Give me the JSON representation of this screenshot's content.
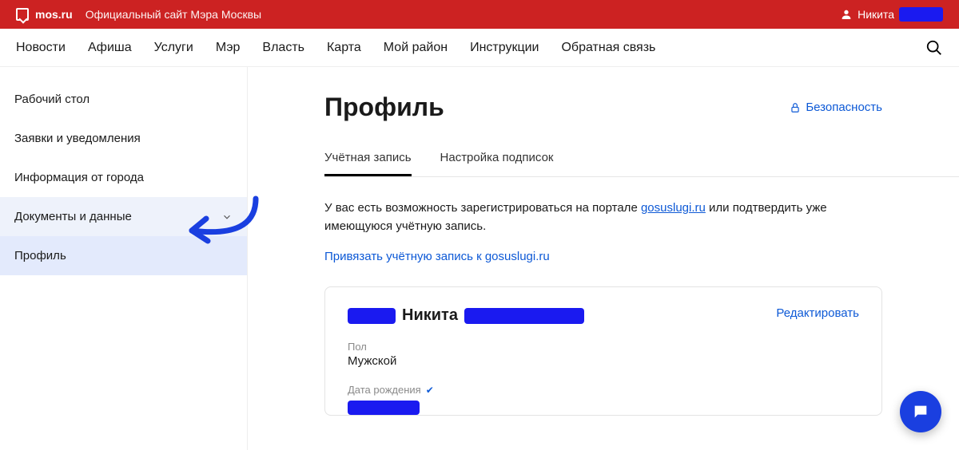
{
  "topbar": {
    "logo": "mos.ru",
    "subtitle": "Официальный сайт Мэра Москвы",
    "user_name": "Никита"
  },
  "nav": {
    "items": [
      "Новости",
      "Афиша",
      "Услуги",
      "Мэр",
      "Власть",
      "Карта",
      "Мой район",
      "Инструкции",
      "Обратная связь"
    ]
  },
  "sidebar": {
    "items": [
      "Рабочий стол",
      "Заявки и уведомления",
      "Информация от города",
      "Документы и данные",
      "Профиль"
    ]
  },
  "page": {
    "title": "Профиль",
    "security": "Безопасность"
  },
  "tabs": {
    "items": [
      "Учётная запись",
      "Настройка подписок"
    ]
  },
  "info": {
    "text_before": "У вас есть возможность зарегистрироваться на портале ",
    "link": "gosuslugi.ru",
    "text_after": " или подтвердить уже имеющуюся учётную запись.",
    "bind_link": "Привязать учётную запись к gosuslugi.ru"
  },
  "card": {
    "name_visible": "Никита",
    "edit": "Редактировать",
    "field_gender_label": "Пол",
    "field_gender_value": "Мужской",
    "field_dob_label": "Дата рождения"
  }
}
